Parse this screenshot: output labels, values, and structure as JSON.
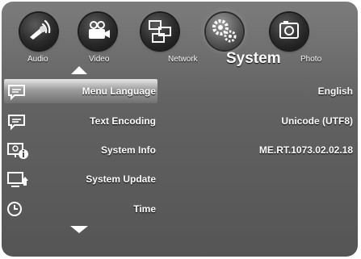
{
  "tabs": [
    {
      "label": "Audio",
      "icon": "audio-icon"
    },
    {
      "label": "Video",
      "icon": "video-camera-icon"
    },
    {
      "label": "Network",
      "icon": "network-icon"
    },
    {
      "label": "System",
      "icon": "gears-icon",
      "active": true
    },
    {
      "label": "Photo",
      "icon": "photo-icon"
    }
  ],
  "menu": [
    {
      "label": "Menu Language",
      "value": "English",
      "icon": "language-speech-icon",
      "selected": true
    },
    {
      "label": "Text Encoding",
      "value": "Unicode (UTF8)",
      "icon": "text-encoding-speech-icon"
    },
    {
      "label": "System Info",
      "value": "ME.RT.1073.02.02.18",
      "icon": "system-info-icon"
    },
    {
      "label": "System Update",
      "value": "",
      "icon": "system-update-icon"
    },
    {
      "label": "Time",
      "value": "",
      "icon": "clock-icon"
    }
  ],
  "colors": {
    "panel": "#626262",
    "highlight": "#9c9c9c",
    "text": "#ffffff"
  }
}
